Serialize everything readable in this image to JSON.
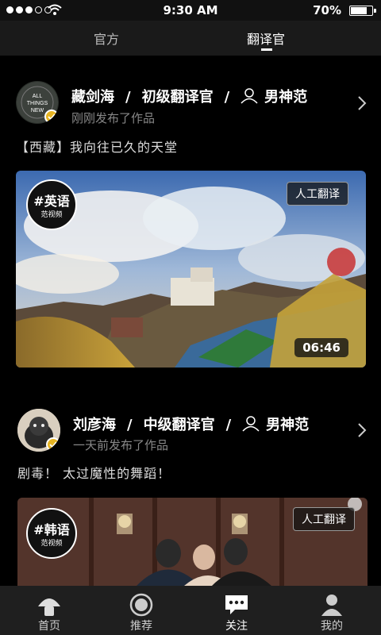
{
  "status_bar": {
    "time": "9:30 AM",
    "battery": "70%"
  },
  "tabs": [
    {
      "label": "官方"
    },
    {
      "label": "翻译官"
    }
  ],
  "posts": [
    {
      "name": "藏剑海",
      "level": "初级翻译官",
      "category": "男神范",
      "time_text": "刚刚发布了作品",
      "caption": "【西藏】我向往已久的天堂",
      "badge_title": "#英语",
      "badge_sub": "范视频",
      "tag": "人工翻译",
      "duration": "06:46",
      "avatar_text": [
        "ALL",
        "THINGS",
        "NEW"
      ]
    },
    {
      "name": "刘彦海",
      "level": "中级翻译官",
      "category": "男神范",
      "time_text": "一天前发布了作品",
      "caption": "剧毒！ 太过魔性的舞蹈！",
      "badge_title": "#韩语",
      "badge_sub": "范视频",
      "tag": "人工翻译"
    }
  ],
  "bottom_nav": [
    {
      "label": "首页",
      "icon": "home-icon"
    },
    {
      "label": "推荐",
      "icon": "recommend-icon"
    },
    {
      "label": "关注",
      "icon": "follow-chat-icon"
    },
    {
      "label": "我的",
      "icon": "profile-icon"
    }
  ],
  "colors": {
    "verify_badge": "#e6b422",
    "bg": "#000000",
    "tabbar": "#1a1a1a"
  }
}
